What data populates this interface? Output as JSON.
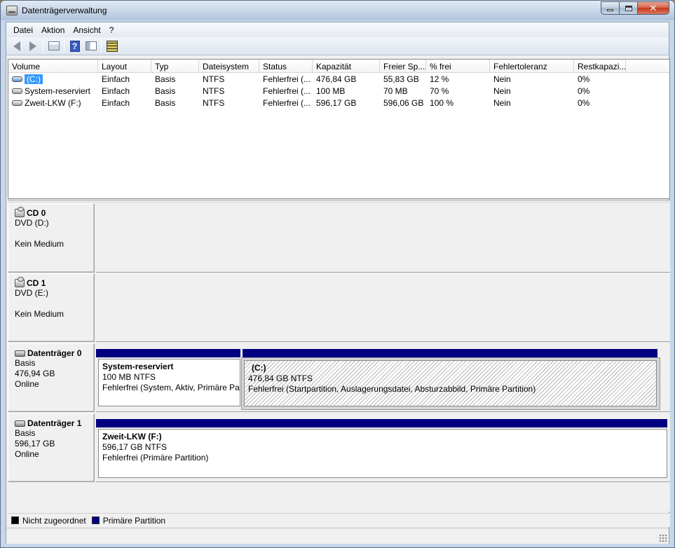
{
  "window": {
    "title": "Datenträgerverwaltung"
  },
  "menu": {
    "datei": "Datei",
    "aktion": "Aktion",
    "ansicht": "Ansicht",
    "hilfe": "?"
  },
  "toolbar": {
    "icons": [
      "back-arrow-icon",
      "forward-arrow-icon",
      "show-pane-icon",
      "help-icon",
      "properties-icon",
      "wizard-icon"
    ]
  },
  "volumes": {
    "columns": [
      "Volume",
      "Layout",
      "Typ",
      "Dateisystem",
      "Status",
      "Kapazität",
      "Freier Sp...",
      "% frei",
      "Fehlertoleranz",
      "Restkapazi..."
    ],
    "rows": [
      {
        "volume": "(C:)",
        "layout": "Einfach",
        "typ": "Basis",
        "dateisystem": "NTFS",
        "status": "Fehlerfrei (...",
        "kapazitaet": "476,84 GB",
        "frei": "55,83 GB",
        "pct": "12 %",
        "fehlertoleranz": "Nein",
        "rest": "0%"
      },
      {
        "volume": "System-reserviert",
        "layout": "Einfach",
        "typ": "Basis",
        "dateisystem": "NTFS",
        "status": "Fehlerfrei (...",
        "kapazitaet": "100 MB",
        "frei": "70 MB",
        "pct": "70 %",
        "fehlertoleranz": "Nein",
        "rest": "0%"
      },
      {
        "volume": "Zweit-LKW (F:)",
        "layout": "Einfach",
        "typ": "Basis",
        "dateisystem": "NTFS",
        "status": "Fehlerfrei (...",
        "kapazitaet": "596,17 GB",
        "frei": "596,06 GB",
        "pct": "100 %",
        "fehlertoleranz": "Nein",
        "rest": "0%"
      }
    ]
  },
  "disks": {
    "cd0": {
      "name": "CD 0",
      "type": "DVD (D:)",
      "state": "Kein Medium"
    },
    "cd1": {
      "name": "CD 1",
      "type": "DVD (E:)",
      "state": "Kein Medium"
    },
    "disk0": {
      "name": "Datenträger 0",
      "type": "Basis",
      "size": "476,94 GB",
      "state": "Online",
      "partitions": [
        {
          "name": "System-reserviert",
          "size": "100 MB NTFS",
          "status": "Fehlerfrei (System, Aktiv, Primäre Par"
        },
        {
          "name": "(C:)",
          "size": "476,84 GB NTFS",
          "status": "Fehlerfrei (Startpartition, Auslagerungsdatei, Absturzabbild, Primäre Partition)"
        }
      ]
    },
    "disk1": {
      "name": "Datenträger 1",
      "type": "Basis",
      "size": "596,17 GB",
      "state": "Online",
      "partitions": [
        {
          "name": "Zweit-LKW  (F:)",
          "size": "596,17 GB NTFS",
          "status": "Fehlerfrei (Primäre Partition)"
        }
      ]
    }
  },
  "legend": {
    "unallocated": {
      "label": "Nicht zugeordnet",
      "color": "#000000"
    },
    "primary": {
      "label": "Primäre Partition",
      "color": "#000080"
    }
  }
}
